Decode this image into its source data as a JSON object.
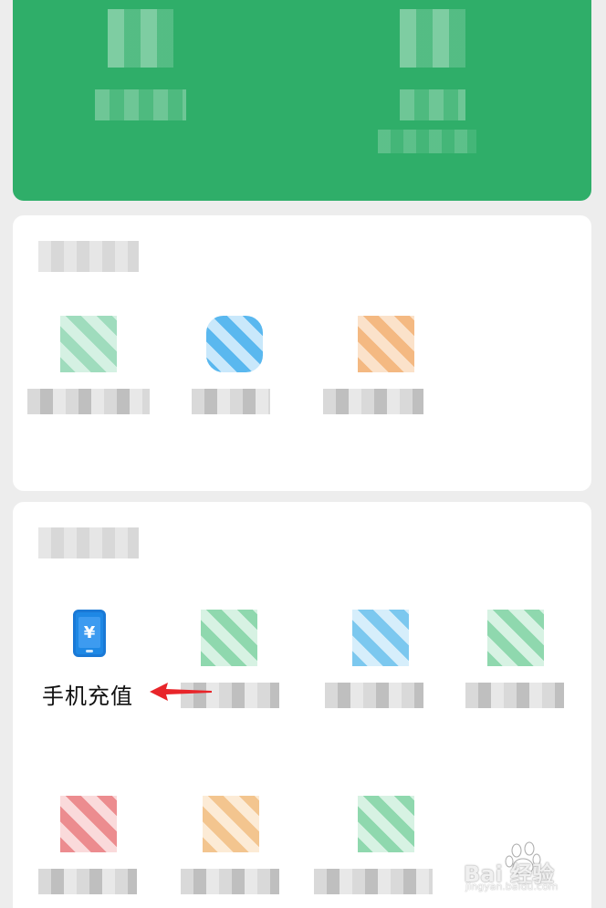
{
  "services": {
    "topup_label": "手机充值",
    "topup_icon": "phone-yuan-icon",
    "topup_currency_symbol": "¥",
    "accent_color": "#2fae69",
    "topup_icon_color": "#1e88e5",
    "arrow_color": "#e8252a"
  },
  "watermark": {
    "brand": "Bai 经验",
    "url": "jingyan.baidu.com"
  }
}
